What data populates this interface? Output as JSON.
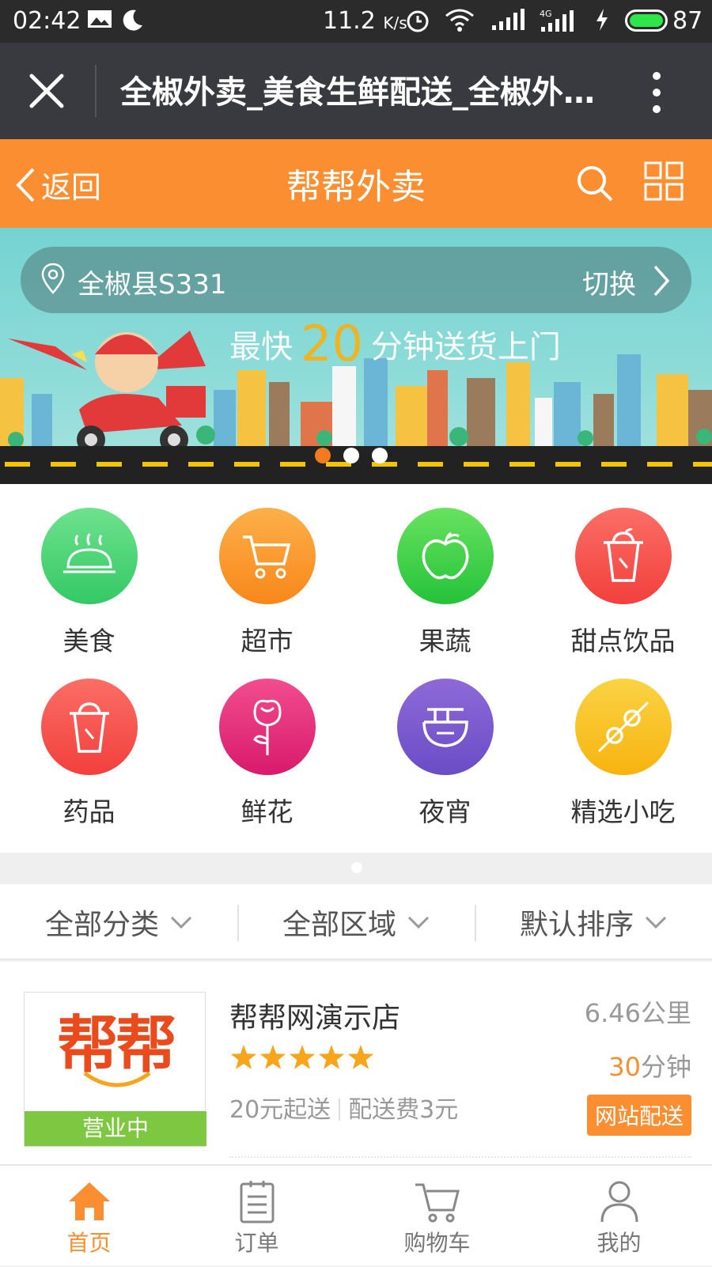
{
  "status_bar": {
    "time": "02:42",
    "speed_value": "11.2",
    "speed_unit": "K/s",
    "battery": "87",
    "icons": [
      "gallery-icon",
      "moon-icon",
      "alarm-icon",
      "wifi-icon",
      "signal-icon",
      "signal-4g-icon",
      "charging-icon",
      "battery-icon"
    ]
  },
  "browser": {
    "title": "全椒外卖_美食生鲜配送_全椒外卖网",
    "icons": [
      "close-icon",
      "more-icon"
    ]
  },
  "header": {
    "back_label": "返回",
    "brand": "帮帮外卖",
    "accent_color": "#fb8e30",
    "icons": [
      "back-chevron-icon",
      "search-icon",
      "grid-icon"
    ]
  },
  "banner": {
    "location": "全椒县S331",
    "switch_label": "切换",
    "slogan_pre": "最快",
    "slogan_num": "20",
    "slogan_post": "分钟送货上门",
    "slides_total": 3,
    "active_slide": 1
  },
  "categories": [
    {
      "label": "美食",
      "icon": "food-cloche-icon",
      "color": "#4cd47a"
    },
    {
      "label": "超市",
      "icon": "shopping-cart-icon",
      "color": "#fb9a2c"
    },
    {
      "label": "果蔬",
      "icon": "apple-icon",
      "color": "#3ed44b"
    },
    {
      "label": "甜点饮品",
      "icon": "drink-cup-icon",
      "color": "#f7534f"
    },
    {
      "label": "药品",
      "icon": "medicine-cup-icon",
      "color": "#f7534f"
    },
    {
      "label": "鲜花",
      "icon": "rose-icon",
      "color": "#e8287a"
    },
    {
      "label": "夜宵",
      "icon": "noodle-bowl-icon",
      "color": "#7d5bd0"
    },
    {
      "label": "精选小吃",
      "icon": "skewer-icon",
      "color": "#f7c21d"
    }
  ],
  "filters": {
    "category": "全部分类",
    "area": "全部区域",
    "sort": "默认排序"
  },
  "store": {
    "logo_text": "帮帮",
    "status": "营业中",
    "name": "帮帮网演示店",
    "rating": 5,
    "min_order": "20元起送",
    "delivery_fee": "配送费3元",
    "distance": "6.46公里",
    "time_value": "30",
    "time_unit": "分钟",
    "delivery_label": "网站配送"
  },
  "tabbar": [
    {
      "label": "首页",
      "icon": "home-icon",
      "active": true
    },
    {
      "label": "订单",
      "icon": "order-icon",
      "active": false
    },
    {
      "label": "购物车",
      "icon": "cart-icon",
      "active": false
    },
    {
      "label": "我的",
      "icon": "user-icon",
      "active": false
    }
  ]
}
